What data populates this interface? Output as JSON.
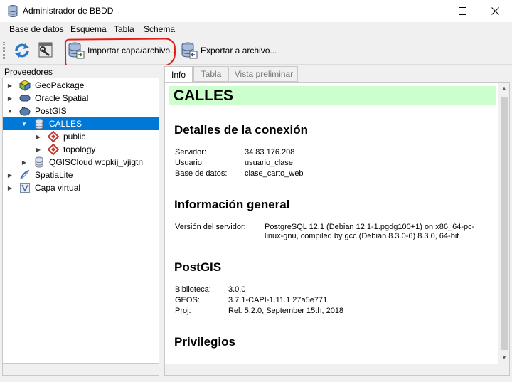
{
  "window": {
    "title": "Administrador de BBDD",
    "controls": {
      "minimize": "—",
      "maximize": "☐",
      "close": "✕"
    }
  },
  "menu": [
    "Base de datos",
    "Esquema",
    "Tabla",
    "Schema"
  ],
  "toolbar": {
    "import_label": "Importar capa/archivo...",
    "export_label": "Exportar a archivo..."
  },
  "providers": {
    "title": "Proveedores",
    "items": [
      {
        "label": "GeoPackage",
        "icon": "geopackage-icon",
        "expanded": false
      },
      {
        "label": "Oracle Spatial",
        "icon": "oracle-icon",
        "expanded": false
      },
      {
        "label": "PostGIS",
        "icon": "postgis-icon",
        "expanded": true
      },
      {
        "label": "CALLES",
        "icon": "database-icon",
        "expanded": true,
        "selected": true
      },
      {
        "label": "public",
        "icon": "schema-icon",
        "expanded": false
      },
      {
        "label": "topology",
        "icon": "schema-icon",
        "expanded": false
      },
      {
        "label": "QGISCloud wcpkij_vjigtn",
        "icon": "database-icon",
        "expanded": false
      },
      {
        "label": "SpatiaLite",
        "icon": "spatialite-icon",
        "expanded": false
      },
      {
        "label": "Capa virtual",
        "icon": "virtual-layer-icon",
        "expanded": false
      }
    ]
  },
  "tabs": [
    "Info",
    "Tabla",
    "Vista preliminar"
  ],
  "info": {
    "title": "CALLES",
    "connection": {
      "heading": "Detalles de la conexión",
      "rows": [
        {
          "key": "Servidor:",
          "value": "34.83.176.208"
        },
        {
          "key": "Usuario:",
          "value": "usuario_clase"
        },
        {
          "key": "Base de datos:",
          "value": "clase_carto_web"
        }
      ]
    },
    "general": {
      "heading": "Información general",
      "server_version_key": "Versión del servidor:",
      "server_version_line1": "PostgreSQL 12.1 (Debian 12.1-1.pgdg100+1) on x86_64-pc-",
      "server_version_line2": "linux-gnu, compiled by gcc (Debian 8.3.0-6) 8.3.0, 64-bit"
    },
    "postgis": {
      "heading": "PostGIS",
      "rows": [
        {
          "key": "Biblioteca:",
          "value": "3.0.0"
        },
        {
          "key": "GEOS:",
          "value": "3.7.1-CAPI-1.11.1 27a5e771"
        },
        {
          "key": "Proj:",
          "value": "Rel. 5.2.0, September 15th, 2018"
        }
      ]
    },
    "privileges": {
      "heading": "Privilegios"
    }
  },
  "colors": {
    "selection": "#0078d7",
    "title_band": "#ccffcc",
    "annotation": "#e0201c"
  }
}
